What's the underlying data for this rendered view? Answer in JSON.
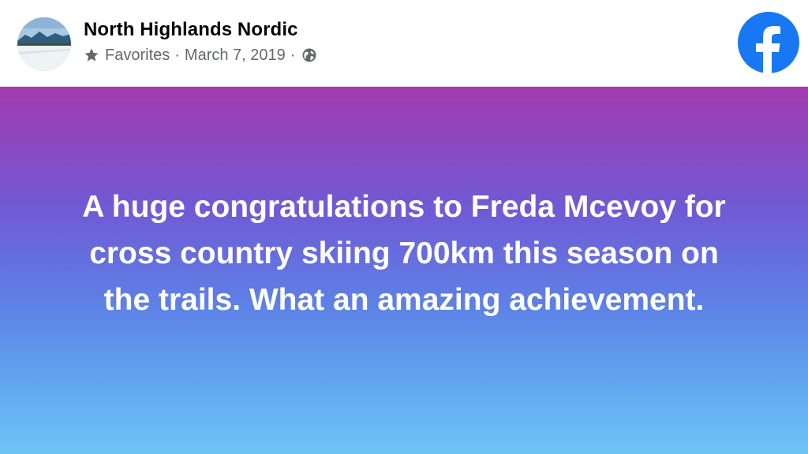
{
  "post": {
    "author": "North Highlands Nordic",
    "audience": "Favorites",
    "separator_1": "·",
    "date": "March 7, 2019",
    "separator_2": "·",
    "privacy_icon": "globe-icon",
    "audience_icon": "star-icon",
    "brand_icon": "facebook-logo",
    "text_lines": [
      "A huge congratulations to Freda Mcevoy for",
      "cross country skiing 700km this season on",
      "the trails. What an amazing achievement."
    ]
  },
  "colors": {
    "facebook_blue": "#1877f2",
    "meta_gray": "#65676b",
    "gradient_top": "#a23ab0",
    "gradient_bottom": "#6dc5f6"
  }
}
